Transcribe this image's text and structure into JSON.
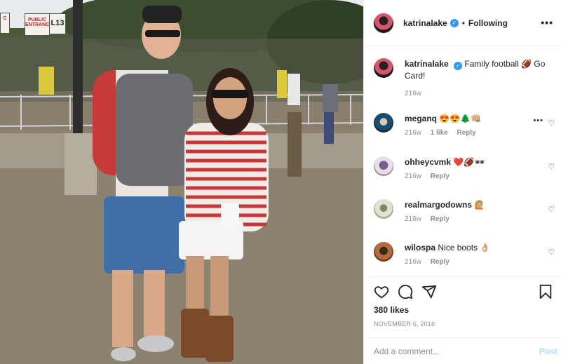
{
  "photo": {
    "signs": {
      "left": "C",
      "public": "PUBLIC ENTRANCE",
      "number": "L13"
    }
  },
  "header": {
    "username": "katrinalake",
    "verified_icon": "verified-badge-icon",
    "separator": "•",
    "follow_status": "Following",
    "more_icon": "ellipsis-icon"
  },
  "caption": {
    "username": "katrinalake",
    "text": "Family football 🏈 Go Card!",
    "time": "216w"
  },
  "comments": [
    {
      "username": "meganq",
      "text": "😍😍🌲👊🏼",
      "time": "216w",
      "likes": "1 like",
      "reply": "Reply"
    },
    {
      "username": "ohheycvmk",
      "text": "❤️🏈🕶",
      "time": "216w",
      "reply": "Reply"
    },
    {
      "username": "realmargodowns",
      "text": "🙋🏼",
      "time": "216w",
      "reply": "Reply"
    },
    {
      "username": "wilospa",
      "text": "Nice boots 👌🏼",
      "time": "216w",
      "reply": "Reply"
    }
  ],
  "actions": {
    "icons": [
      "heart-icon",
      "comment-icon",
      "share-icon",
      "bookmark-icon"
    ],
    "likes": "380 likes",
    "date": "NOVEMBER 6, 2016"
  },
  "add_comment": {
    "placeholder": "Add a comment...",
    "post_label": "Post"
  },
  "colors": {
    "verified": "#3897f0",
    "muted": "#8e8e8e",
    "post_disabled": "#b2dffc",
    "heart": "#ed4956"
  }
}
